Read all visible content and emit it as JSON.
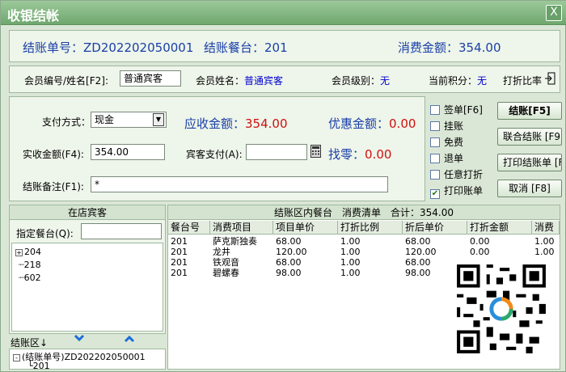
{
  "window": {
    "title": "收银结帐",
    "close_glyph": "X"
  },
  "header": {
    "bill_no_label": "结账单号：",
    "bill_no": "ZD202202050001",
    "table_label": "结账餐台：",
    "table": "201",
    "amount_label": "消费金额：",
    "amount": "354.00"
  },
  "member": {
    "id_label": "会员编号/姓名[F2]:",
    "id_value": "普通宾客",
    "name_label": "会员姓名：",
    "name_value": "普通宾客",
    "level_label": "会员级别：",
    "level_value": "无",
    "points_label": "当前积分：",
    "points_value": "无",
    "discount_label": "打折比率"
  },
  "payment": {
    "method_label": "支付方式：",
    "method_value": "现金",
    "receivable_label": "应收金额：",
    "receivable_value": "354.00",
    "discount_label": "优惠金额：",
    "discount_value": "0.00",
    "paid_label": "实收金额(F4):",
    "paid_value": "354.00",
    "guest_pay_label": "宾客支付(A):",
    "guest_pay_value": "",
    "change_label": "找零：",
    "change_value": "0.00",
    "note_label": "结账备注(F1):",
    "note_value": "*"
  },
  "options": [
    {
      "label": "签单[F6]",
      "checked": false
    },
    {
      "label": "挂账",
      "checked": false
    },
    {
      "label": "免费",
      "checked": false
    },
    {
      "label": "退单",
      "checked": false
    },
    {
      "label": "任意打折",
      "checked": false
    },
    {
      "label": "打印账单",
      "checked": true
    }
  ],
  "buttons": {
    "checkout": "结账[F5]",
    "joint_checkout": "联合结账 [F9]",
    "print_bill": "打印结账单 [F",
    "cancel": "取消 [F8]"
  },
  "guests": {
    "title": "在店宾客",
    "filter_label": "指定餐台(Q):",
    "filter_value": "",
    "tables": [
      "204",
      "218",
      "602"
    ]
  },
  "consume": {
    "title": "结账区内餐台　消费清单　合计：354.00",
    "columns": [
      "餐台号",
      "消费项目",
      "项目单价",
      "打折比例",
      "折后单价",
      "打折金额",
      "消费"
    ],
    "rows": [
      [
        "201",
        "萨克斯独奏",
        "68.00",
        "1.00",
        "68.00",
        "0.00",
        "1.00"
      ],
      [
        "201",
        "龙井",
        "120.00",
        "1.00",
        "120.00",
        "0.00",
        "1.00"
      ],
      [
        "201",
        "铁观音",
        "68.00",
        "1.00",
        "68.00",
        "",
        ""
      ],
      [
        "201",
        "碧螺春",
        "98.00",
        "1.00",
        "98.00",
        "",
        ""
      ]
    ]
  },
  "checkout_area": {
    "label": "结账区↓",
    "node_label": "(结账单号)ZD202202050001",
    "child": "201"
  },
  "icons": {
    "calculator": "calculator-icon",
    "down": "chevron-down-icon",
    "up": "chevron-up-icon"
  }
}
